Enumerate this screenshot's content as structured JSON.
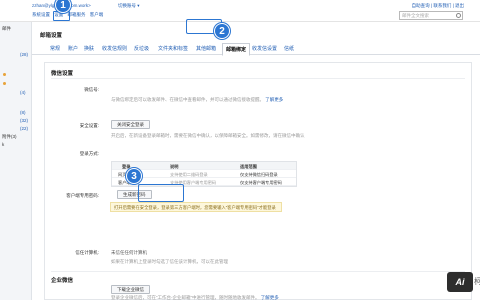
{
  "header": {
    "user_email": "zzhan@ylg321.wecom.work>",
    "switch_label": "切换账号 ▾",
    "links": [
      "系统设置",
      "设置",
      "邮箱服务",
      "客户端"
    ],
    "right_links": "自助查询 | 联系我们 | 退出",
    "search_placeholder": "邮件全文搜索"
  },
  "sidebar": {
    "items": [
      "邮件",
      "(28)",
      "(4)",
      "(8)",
      "(32)",
      "(22)",
      "附件(3)",
      "k"
    ]
  },
  "page": {
    "title": "邮箱设置",
    "tabs": [
      "常规",
      "账户",
      "换肤",
      "收发信规则",
      "反垃圾",
      "文件夹和标签",
      "其他邮箱",
      "邮箱绑定",
      "收发信设置",
      "信纸"
    ],
    "active_tab_index": 7
  },
  "wechat_binding": {
    "section_title": "微信设置",
    "wechat_label": "微信号:",
    "wechat_desc": "与微信绑定后可以收发邮件、在微信中查看邮件，并可以通过微信接收提醒。",
    "wechat_more": "了解更多",
    "security_label": "安全设置:",
    "security_button": "关闭安全登录",
    "security_desc": "开启后，在新设备登录邮箱时，需要在微信中确认，以保障邮箱安全。如需修改，请在微信中确认",
    "login_label": "登录方式:",
    "table_headers": [
      "登录",
      "说明",
      "适用范围"
    ],
    "table_rows": [
      [
        "网页端登录",
        "支持使用二维码登录",
        "仅支持微信扫码登录"
      ],
      [
        "客户端登录",
        "支持使用客户端专用密码",
        "仅支持客户端专用密码"
      ]
    ],
    "client_pwd_label": "客户端专用密码:",
    "generate_button": "生成新密码",
    "callout_text": "打开后需要在安全登录，登录第三方客户端时，您需要输入“客户端专用密码”才能登录",
    "trusted_label": "信任计算机:",
    "trusted_desc": "未信任任何计算机",
    "trusted_sub": "如果在计算机上登录时勾选了信任该计算机，可以在此管理"
  },
  "enterprise_wechat": {
    "section_title": "企业微信",
    "button": "下载企业微信",
    "desc": "登录企业微信后，可在“工作台-企业邮箱”中进行管理，随时随地收发邮件。",
    "more": "了解更多"
  },
  "annotations": [
    "1",
    "2",
    "3"
  ],
  "logo_text": "Ai",
  "logo_tail": "柯"
}
